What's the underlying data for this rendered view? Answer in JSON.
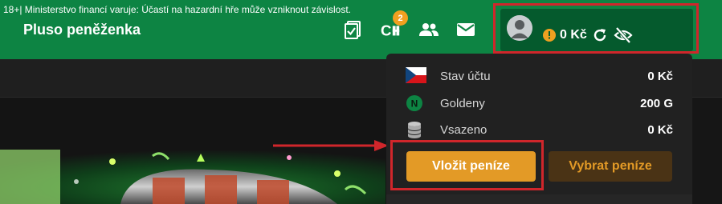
{
  "header": {
    "warning": "18+| Ministerstvo financí varuje: Účastí na hazardní hře může vzniknout závislost.",
    "title": "Pluso peněženka",
    "notification_count": "2",
    "icons": [
      "tickets-icon",
      "chat-icon",
      "friends-icon",
      "mail-icon"
    ]
  },
  "account": {
    "balance": "0 Kč",
    "icons": [
      "avatar",
      "alert-icon",
      "refresh-icon",
      "hide-balance-icon"
    ]
  },
  "wallet": {
    "rows": [
      {
        "icon": "czech-flag-icon",
        "label": "Stav účtu",
        "value": "0 Kč"
      },
      {
        "icon": "goldeny-coin-icon",
        "label": "Goldeny",
        "value": "200 G",
        "coin_letter": "N"
      },
      {
        "icon": "coins-stack-icon",
        "label": "Vsazeno",
        "value": "0 Kč"
      }
    ],
    "deposit_label": "Vložit peníze",
    "withdraw_label": "Vybrat peníze"
  },
  "colors": {
    "header_green": "#0d8443",
    "pill_green": "#055a2d",
    "accent_orange": "#e39a26",
    "highlight_red": "#d0262b",
    "badge_orange": "#f0a020"
  }
}
